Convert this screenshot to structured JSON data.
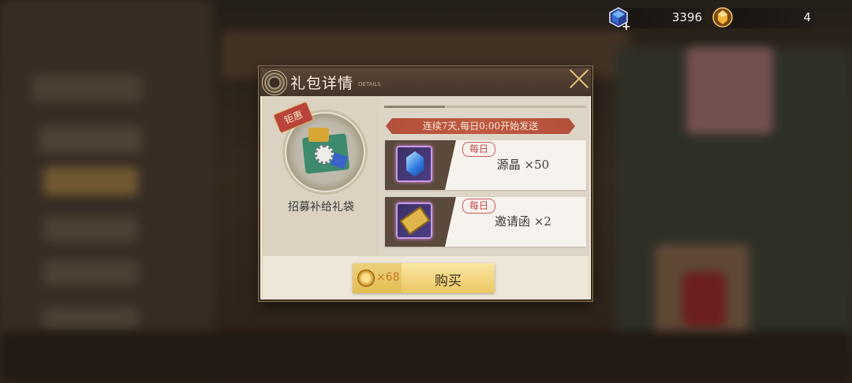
{
  "resources": {
    "crystal": {
      "value": "3396",
      "plus": "+",
      "icon": "crystal-icon"
    },
    "gold": {
      "value": "4",
      "icon": "gold-crystal-icon"
    }
  },
  "dialog": {
    "title": "礼包详情",
    "title_en": "DETAILS",
    "close_icon": "close-icon",
    "pack": {
      "ribbon": "钜惠",
      "name": "招募补给礼袋"
    },
    "banner": "连续7天,每日0:00开始发送",
    "progress": 0.3,
    "items": [
      {
        "tag": "每日",
        "name": "源晶 ×50",
        "icon": "source-crystal-icon"
      },
      {
        "tag": "每日",
        "name": "邀请函 ×2",
        "icon": "invitation-ticket-icon"
      }
    ],
    "buy": {
      "price": "×68",
      "label": "购买",
      "currency_icon": "gold-coin-icon"
    }
  },
  "colors": {
    "banner": "#b24f3a",
    "header": "#4f3d30",
    "buy_button": "#ecc863",
    "daily_tag": "#c04a4a"
  }
}
